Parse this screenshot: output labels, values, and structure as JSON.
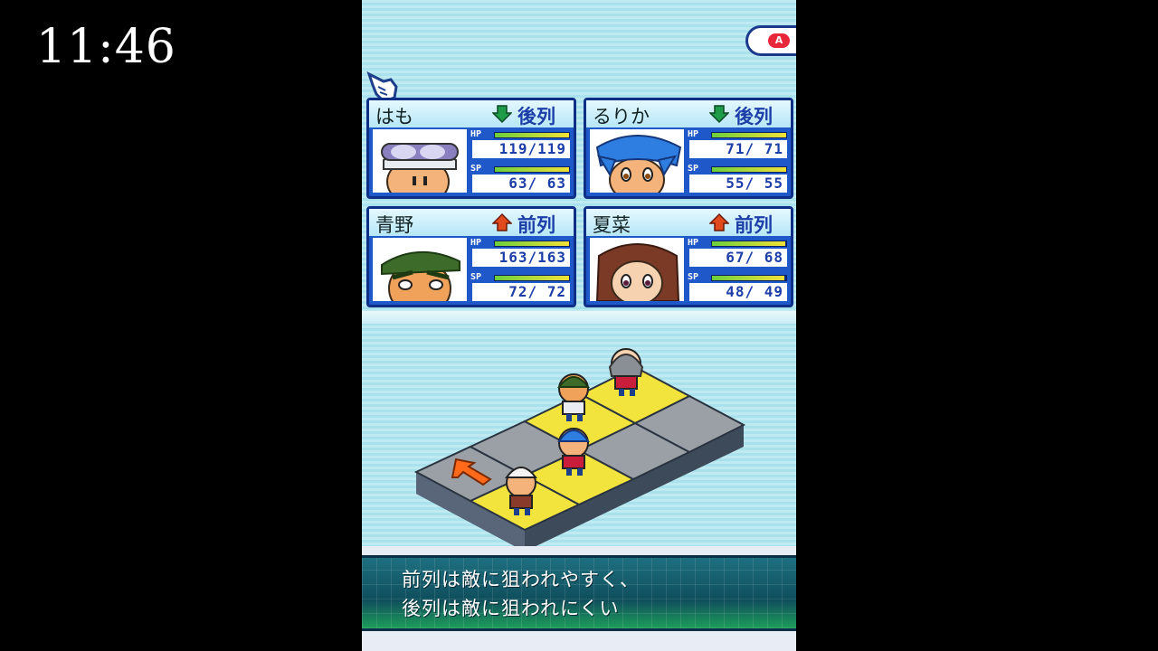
{
  "overlay": {
    "timer": "11:46"
  },
  "controls": {
    "a_button": "A"
  },
  "party": [
    {
      "name": "はも",
      "row": "後列",
      "row_icon": "arrow-down-icon",
      "hp": "119/119",
      "hp_fraction": 1.0,
      "sp": "63/ 63",
      "sp_fraction": 1.0
    },
    {
      "name": "るりか",
      "row": "後列",
      "row_icon": "arrow-down-icon",
      "hp": "71/ 71",
      "hp_fraction": 1.0,
      "sp": "55/ 55",
      "sp_fraction": 1.0
    },
    {
      "name": "青野",
      "row": "前列",
      "row_icon": "arrow-up-icon",
      "hp": "163/163",
      "hp_fraction": 1.0,
      "sp": "72/ 72",
      "sp_fraction": 1.0
    },
    {
      "name": "夏菜",
      "row": "前列",
      "row_icon": "arrow-up-icon",
      "hp": "67/ 68",
      "hp_fraction": 0.985,
      "sp": "48/ 49",
      "sp_fraction": 0.98
    }
  ],
  "stat_labels": {
    "hp": "HP",
    "sp": "SP"
  },
  "message": {
    "line1": "前列は敵に狙われやすく、",
    "line2": "後列は敵に狙われにくい"
  },
  "colors": {
    "card_blue": "#1f58c8",
    "back_row_arrow": "#1f9c4a",
    "front_row_arrow": "#e04a1c",
    "tile_yellow": "#f2e43c",
    "tile_gray": "#9aa0a6"
  }
}
